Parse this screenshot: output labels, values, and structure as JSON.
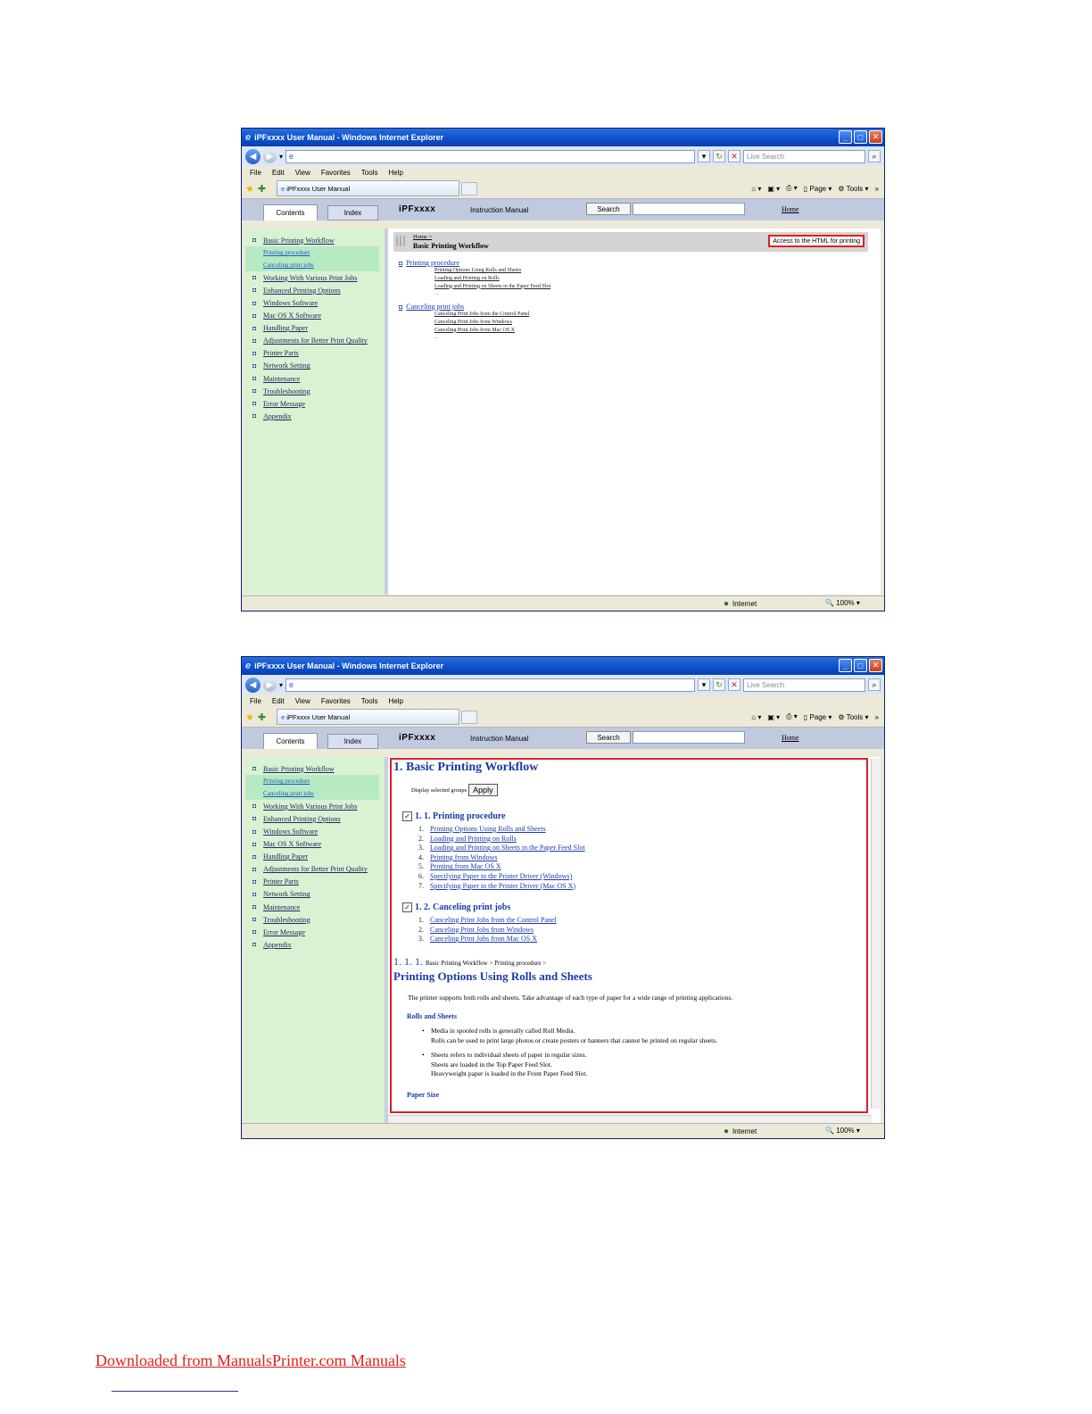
{
  "browser": {
    "title": "iPFxxxx User Manual - Windows Internet Explorer",
    "live_search_placeholder": "Live Search",
    "menu": [
      "File",
      "Edit",
      "View",
      "Favorites",
      "Tools",
      "Help"
    ],
    "tab_title": "iPFxxxx User Manual",
    "cmd_page": "Page",
    "cmd_tools": "Tools",
    "status_zone": "Internet",
    "status_zoom": "100%"
  },
  "manual_header": {
    "tab_contents": "Contents",
    "tab_index": "Index",
    "brand": "iPFxxxx",
    "manual_label": "Instruction Manual",
    "search_button": "Search",
    "home_link": "Home"
  },
  "sidebar": {
    "items": [
      {
        "label": "Basic Printing Workflow",
        "sub": false
      },
      {
        "label": "Printing procedure",
        "sub": true
      },
      {
        "label": "Canceling print jobs",
        "sub": true
      },
      {
        "label": "Working With Various Print Jobs",
        "sub": false
      },
      {
        "label": "Enhanced Printing Options",
        "sub": false
      },
      {
        "label": "Windows Software",
        "sub": false
      },
      {
        "label": "Mac OS X Software",
        "sub": false
      },
      {
        "label": "Handling Paper",
        "sub": false
      },
      {
        "label": "Adjustments for Better Print Quality",
        "sub": false
      },
      {
        "label": "Printer Parts",
        "sub": false
      },
      {
        "label": "Network Setting",
        "sub": false
      },
      {
        "label": "Maintenance",
        "sub": false
      },
      {
        "label": "Troubleshooting",
        "sub": false
      },
      {
        "label": "Error Message",
        "sub": false
      },
      {
        "label": "Appendix",
        "sub": false
      }
    ]
  },
  "window1": {
    "breadcrumb_home": "Home >",
    "page_title": "Basic Printing Workflow",
    "access_button": "Access to the HTML for printing",
    "section1_title": "Printing procedure",
    "section1_items": [
      "Printing Options Using Rolls and Sheets",
      "Loading and Printing on Rolls",
      "Loading and Printing on Sheets in the Paper Feed Slot"
    ],
    "section2_title": "Canceling print jobs",
    "section2_items": [
      "Canceling Print Jobs from the Control Panel",
      "Canceling Print Jobs from Windows",
      "Canceling Print Jobs from Mac OS X"
    ],
    "ellipsis": "..."
  },
  "window2": {
    "h1": "1. Basic Printing Workflow",
    "display_groups": "Display selected groups",
    "apply_button": "Apply",
    "group1_title": "1. 1. Printing procedure",
    "group1_items": [
      "Printing Options Using Rolls and Sheets",
      "Loading and Printing on Rolls",
      "Loading and Printing on Sheets in the Paper Feed Slot",
      "Printing from Windows",
      "Printing from Mac OS X",
      "Specifying Paper in the Printer Driver (Windows)",
      "Specifying Paper in the Printer Driver (Mac OS X)"
    ],
    "group2_title": "1. 2. Canceling print jobs",
    "group2_items": [
      "Canceling Print Jobs from the Control Panel",
      "Canceling Print Jobs from Windows",
      "Canceling Print Jobs from Mac OS X"
    ],
    "section_number": "1. 1. 1.",
    "section_crumb": "Basic Printing Workflow > Printing procedure >",
    "section_title": "Printing Options Using Rolls and Sheets",
    "intro": "The printer supports both rolls and sheets. Take advantage of each type of paper for a wide range of printing applications.",
    "rolls_heading": "Rolls and Sheets",
    "bullet1_line1": "Media in spooled rolls is generally called Roll Media.",
    "bullet1_line2": "Rolls can be used to print large photos or create posters or banners that cannot be printed on regular sheets.",
    "bullet2_line1": "Sheets refers to individual sheets of paper in regular sizes.",
    "bullet2_line2": "Sheets are loaded in the Top Paper Feed Slot.",
    "bullet2_line3": "Heavyweight paper is loaded in the Front Paper Feed Slot.",
    "paper_size_heading": "Paper Size"
  },
  "footer": {
    "link": "Downloaded from ManualsPrinter.com Manuals"
  },
  "colors": {
    "highlight_frame": "#d8202a",
    "sidebar_bg": "#d9f2d2",
    "link_blue": "#1a3aa8"
  }
}
